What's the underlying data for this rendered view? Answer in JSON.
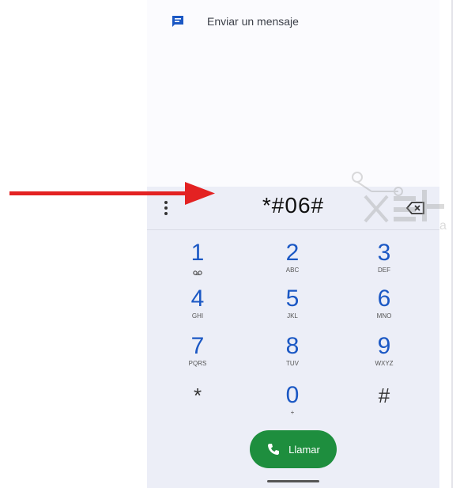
{
  "top": {
    "send_message_label": "Enviar un mensaje",
    "send_message_icon": "message-icon"
  },
  "number_display": {
    "value": "*#06#",
    "more_icon": "more-vert-icon",
    "backspace_icon": "backspace-icon"
  },
  "keys": [
    {
      "num": "1",
      "sub": "voicemail-icon"
    },
    {
      "num": "2",
      "sub": "ABC"
    },
    {
      "num": "3",
      "sub": "DEF"
    },
    {
      "num": "4",
      "sub": "GHI"
    },
    {
      "num": "5",
      "sub": "JKL"
    },
    {
      "num": "6",
      "sub": "MNO"
    },
    {
      "num": "7",
      "sub": "PQRS"
    },
    {
      "num": "8",
      "sub": "TUV"
    },
    {
      "num": "9",
      "sub": "WXYZ"
    },
    {
      "num": "*",
      "sub": ""
    },
    {
      "num": "0",
      "sub": "+"
    },
    {
      "num": "#",
      "sub": ""
    }
  ],
  "call_button": {
    "label": "Llamar",
    "icon": "phone-icon"
  },
  "colors": {
    "accent": "#1b58c4",
    "call_green": "#1e8e3e",
    "arrow_red": "#e32222"
  },
  "annotation": {
    "arrow": "red-arrow-icon"
  },
  "watermark": {
    "text": "Xataka"
  }
}
